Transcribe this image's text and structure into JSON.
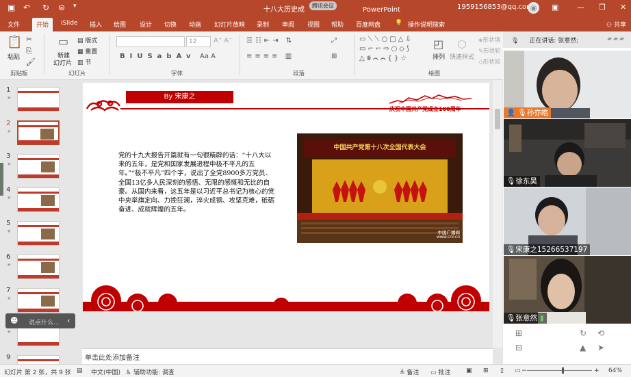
{
  "window": {
    "title": "十八大历史成",
    "app_name": "PowerPoint",
    "meeting_label": "腾讯会议",
    "account": "1959156853@qq.com"
  },
  "menus": [
    "文件",
    "开始",
    "iSlide",
    "插入",
    "绘图",
    "设计",
    "切换",
    "动画",
    "幻灯片放映",
    "录制",
    "审阅",
    "视图",
    "帮助",
    "百度网盘",
    "操作说明搜索"
  ],
  "share_label": "共享",
  "ribbon": {
    "clipboard": {
      "paste": "粘贴",
      "group": "剪贴板"
    },
    "slides": {
      "new_slide_1": "新建",
      "new_slide_2": "幻灯片",
      "layout": "版式",
      "reset": "重置",
      "section": "节",
      "group": "幻灯片"
    },
    "font": {
      "size": "12",
      "group": "字体"
    },
    "paragraph": {
      "group": "段落"
    },
    "drawing": {
      "arrange": "排列",
      "quick_styles": "快速样式",
      "group": "绘图",
      "fill": "形状填",
      "outline": "形状轮",
      "effect": "形状效"
    }
  },
  "thumbnails": [
    "1",
    "2",
    "3",
    "4",
    "5",
    "6",
    "7",
    "8",
    "9"
  ],
  "slide": {
    "author_bar": "By 宋康之",
    "anniversary": "庆祝中国共产党成立100周年",
    "body": "党的十九大报告开篇就有一句很精辟的话：“十八大以来的五年，是党和国家发展进程中极不平凡的五年。”“极不平凡”四个字，说出了全党8900多万党员、全国13亿多人民深刻的感悟、无限的感慨和无比的自豪。从国内来看，这五年是以习近平总书记为核心的党中央举旗定向、力挽狂澜，淬火成钢、攻坚克难，砥砺奋进、成就辉煌的五年。",
    "photo_banner": "中国共产党第十八次全国代表大会",
    "photo_credit_1": "中国广播网",
    "photo_credit_2": "www.cnr.cn"
  },
  "notes_placeholder": "单击此处添加备注",
  "status": {
    "slide_pos": "幻灯片 第 2 张，共 9 张",
    "language": "中文(中国)",
    "accessibility": "辅助功能: 调查",
    "notes": "备注",
    "comments": "批注",
    "zoom": "64%"
  },
  "meeting": {
    "speaking_label": "正在讲话: 张意然;",
    "participants": [
      "孙亦皓",
      "徐东昊",
      "宋康之15266537197",
      "张意然"
    ],
    "float_text": "说点什么..."
  },
  "colors": {
    "accent": "#b7472a",
    "slide_red": "#c00000"
  }
}
